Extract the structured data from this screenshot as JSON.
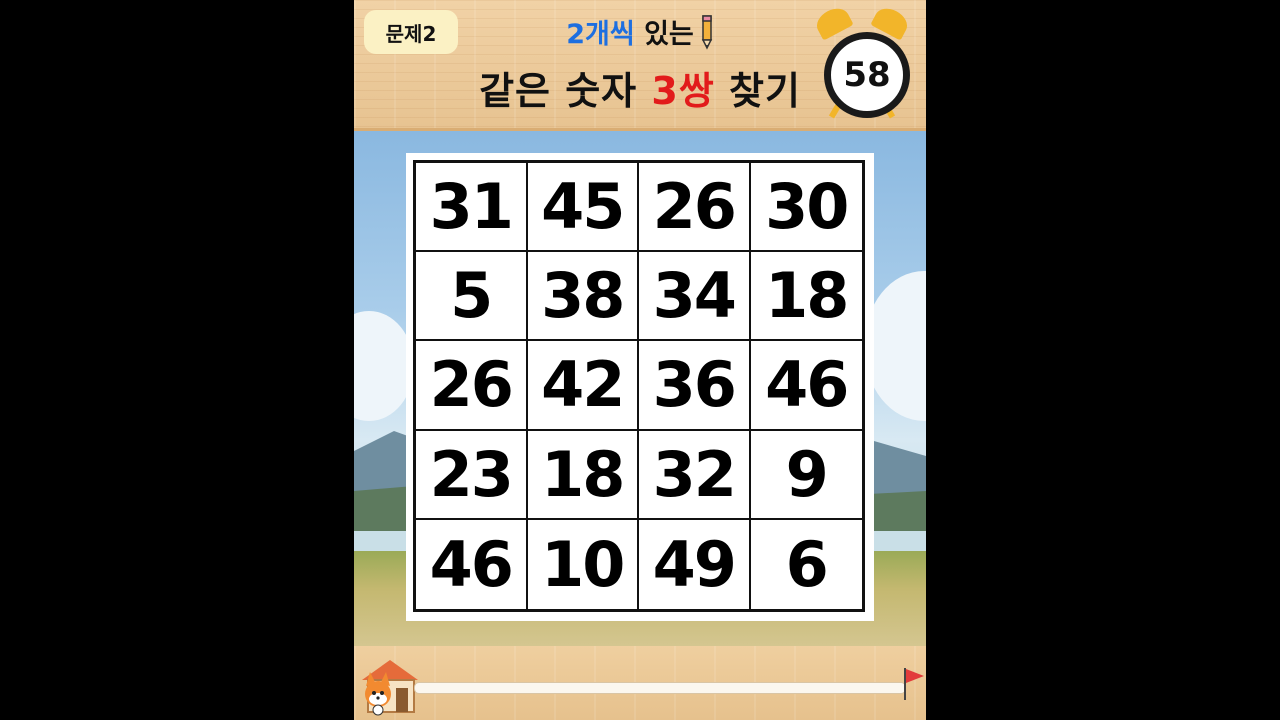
{
  "header": {
    "badge": "문제2",
    "line1_highlight": "2개씩",
    "line1_rest": " 있는",
    "line2_pre": "같은 숫자 ",
    "line2_highlight": "3쌍",
    "line2_post": " 찾기"
  },
  "timer": {
    "seconds": "58"
  },
  "grid": {
    "rows": [
      [
        "31",
        "45",
        "26",
        "30"
      ],
      [
        "5",
        "38",
        "34",
        "18"
      ],
      [
        "26",
        "42",
        "36",
        "46"
      ],
      [
        "23",
        "18",
        "32",
        "9"
      ],
      [
        "46",
        "10",
        "49",
        "6"
      ]
    ]
  },
  "progress": {
    "fraction": 0.0
  },
  "colors": {
    "accent_blue": "#1e6fe0",
    "accent_red": "#e21b1b",
    "timer_bell": "#f2b52a"
  },
  "icons": [
    "pencil-icon",
    "alarm-clock-icon",
    "fox-character-icon",
    "house-icon",
    "flag-icon"
  ]
}
